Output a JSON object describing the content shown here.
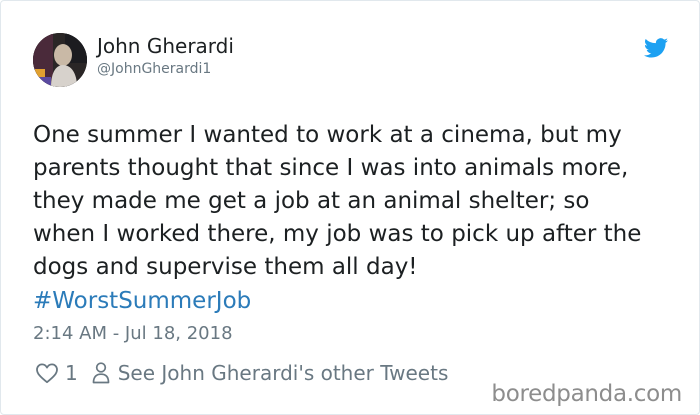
{
  "tweet": {
    "author": {
      "name": "John Gherardi",
      "handle": "@JohnGherardi1"
    },
    "text": "One summer I wanted to work at a cinema, but my\nparents thought that since I was into animals more,\nthey made me get a job at an animal shelter; so\nwhen I worked there, my job was to pick up after the\ndogs and supervise them all day!",
    "hashtag": "#WorstSummerJob",
    "timestamp": "2:14 AM - Jul 18, 2018",
    "likes": "1",
    "other_tweets_label": "See John Gherardi's other Tweets"
  },
  "watermark": "boredpanda.com",
  "icons": {
    "brand": "twitter-bird-icon",
    "like": "heart-icon",
    "profile": "person-icon"
  },
  "colors": {
    "link": "#2b7bb9",
    "twitter_blue": "#1da1f2",
    "muted": "#697882",
    "text": "#1c2022"
  }
}
